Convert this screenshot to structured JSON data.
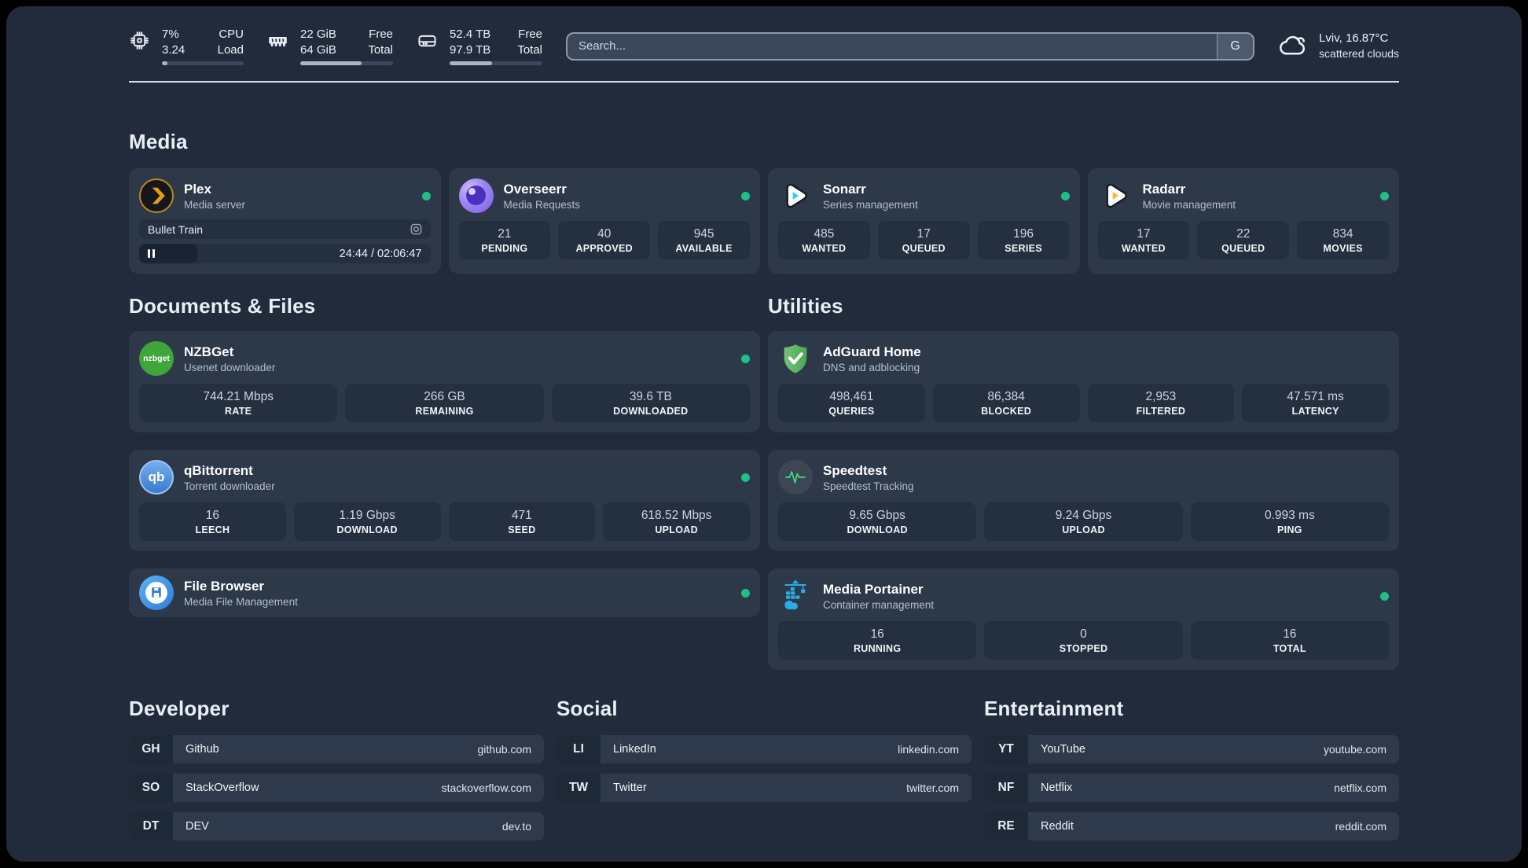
{
  "colors": {
    "page_background": "#212b3b",
    "card_background": "#2d3849",
    "stat_box_background": "#242f40",
    "status_online": "#1dc186",
    "plex_accent": "#e5a00d",
    "sonarr_accent": "#38c6f4",
    "radarr_accent": "#ffb52e",
    "adguard_accent": "#4aa84f",
    "speedtest_accent": "#3ddc84",
    "portainer_accent": "#2cace4"
  },
  "topbar": {
    "cpu": {
      "values": [
        "7%",
        "3.24"
      ],
      "labels": [
        "CPU",
        "Load"
      ],
      "progress": 7
    },
    "ram": {
      "values": [
        "22 GiB",
        "64 GiB"
      ],
      "labels": [
        "Free",
        "Total"
      ],
      "progress": 66
    },
    "disk": {
      "values": [
        "52.4 TB",
        "97.9 TB"
      ],
      "labels": [
        "Free",
        "Total"
      ],
      "progress": 46
    },
    "search": {
      "placeholder": "Search...",
      "engine_button": "G"
    },
    "weather": {
      "location": "Lviv, 16.87°C",
      "condition": "scattered clouds"
    }
  },
  "sections": {
    "media": {
      "title": "Media",
      "apps": [
        {
          "name": "Plex",
          "subtitle": "Media server",
          "status": "online",
          "player": {
            "title": "Bullet Train",
            "time": "24:44 / 02:06:47",
            "progress": 20
          }
        },
        {
          "name": "Overseerr",
          "subtitle": "Media Requests",
          "status": "online",
          "stats": [
            {
              "value": "21",
              "label": "PENDING"
            },
            {
              "value": "40",
              "label": "APPROVED"
            },
            {
              "value": "945",
              "label": "AVAILABLE"
            }
          ]
        },
        {
          "name": "Sonarr",
          "subtitle": "Series management",
          "status": "online",
          "stats": [
            {
              "value": "485",
              "label": "WANTED"
            },
            {
              "value": "17",
              "label": "QUEUED"
            },
            {
              "value": "196",
              "label": "SERIES"
            }
          ]
        },
        {
          "name": "Radarr",
          "subtitle": "Movie management",
          "status": "online",
          "stats": [
            {
              "value": "17",
              "label": "WANTED"
            },
            {
              "value": "22",
              "label": "QUEUED"
            },
            {
              "value": "834",
              "label": "MOVIES"
            }
          ]
        }
      ]
    },
    "documents": {
      "title": "Documents & Files",
      "apps": [
        {
          "name": "NZBGet",
          "subtitle": "Usenet downloader",
          "status": "online",
          "stats": [
            {
              "value": "744.21 Mbps",
              "label": "RATE"
            },
            {
              "value": "266 GB",
              "label": "REMAINING"
            },
            {
              "value": "39.6 TB",
              "label": "DOWNLOADED"
            }
          ]
        },
        {
          "name": "qBittorrent",
          "subtitle": "Torrent downloader",
          "status": "online",
          "stats": [
            {
              "value": "16",
              "label": "LEECH"
            },
            {
              "value": "1.19 Gbps",
              "label": "DOWNLOAD"
            },
            {
              "value": "471",
              "label": "SEED"
            },
            {
              "value": "618.52 Mbps",
              "label": "UPLOAD"
            }
          ]
        },
        {
          "name": "File Browser",
          "subtitle": "Media File Management",
          "status": "online"
        }
      ]
    },
    "utilities": {
      "title": "Utilities",
      "apps": [
        {
          "name": "AdGuard Home",
          "subtitle": "DNS and adblocking",
          "stats": [
            {
              "value": "498,461",
              "label": "QUERIES"
            },
            {
              "value": "86,384",
              "label": "BLOCKED"
            },
            {
              "value": "2,953",
              "label": "FILTERED"
            },
            {
              "value": "47.571 ms",
              "label": "LATENCY"
            }
          ]
        },
        {
          "name": "Speedtest",
          "subtitle": "Speedtest Tracking",
          "stats": [
            {
              "value": "9.65 Gbps",
              "label": "DOWNLOAD"
            },
            {
              "value": "9.24 Gbps",
              "label": "UPLOAD"
            },
            {
              "value": "0.993 ms",
              "label": "PING"
            }
          ]
        },
        {
          "name": "Media Portainer",
          "subtitle": "Container management",
          "status": "online",
          "stats": [
            {
              "value": "16",
              "label": "RUNNING"
            },
            {
              "value": "0",
              "label": "STOPPED"
            },
            {
              "value": "16",
              "label": "TOTAL"
            }
          ]
        }
      ]
    },
    "developer": {
      "title": "Developer",
      "links": [
        {
          "abbr": "GH",
          "name": "Github",
          "url": "github.com"
        },
        {
          "abbr": "SO",
          "name": "StackOverflow",
          "url": "stackoverflow.com"
        },
        {
          "abbr": "DT",
          "name": "DEV",
          "url": "dev.to"
        }
      ]
    },
    "social": {
      "title": "Social",
      "links": [
        {
          "abbr": "LI",
          "name": "LinkedIn",
          "url": "linkedin.com"
        },
        {
          "abbr": "TW",
          "name": "Twitter",
          "url": "twitter.com"
        }
      ]
    },
    "entertainment": {
      "title": "Entertainment",
      "links": [
        {
          "abbr": "YT",
          "name": "YouTube",
          "url": "youtube.com"
        },
        {
          "abbr": "NF",
          "name": "Netflix",
          "url": "netflix.com"
        },
        {
          "abbr": "RE",
          "name": "Reddit",
          "url": "reddit.com"
        }
      ]
    }
  }
}
